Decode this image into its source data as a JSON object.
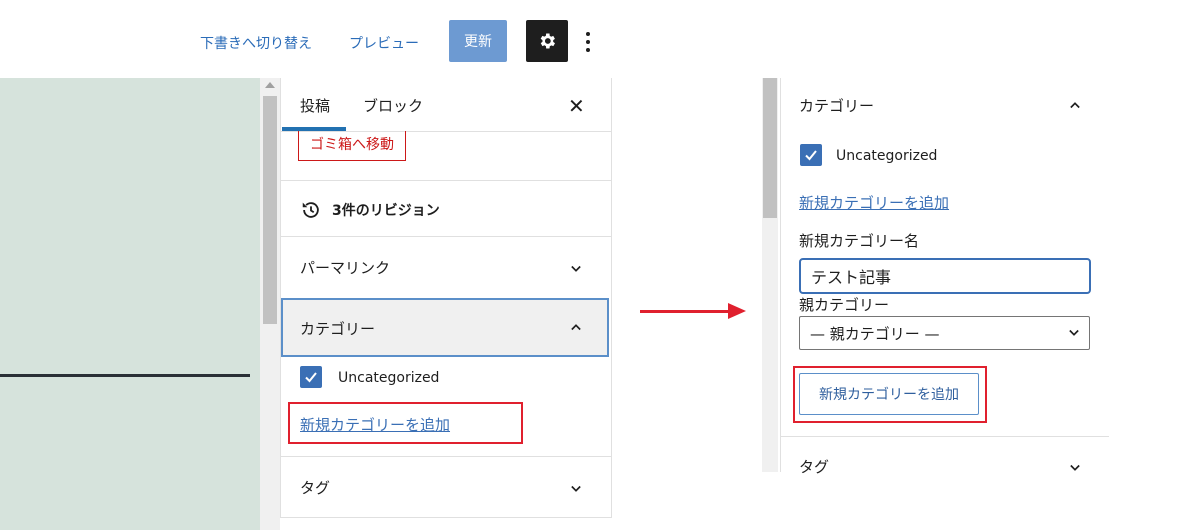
{
  "toolbar": {
    "switch_to_draft": "下書きへ切り替え",
    "preview": "プレビュー",
    "update": "更新"
  },
  "sidebar": {
    "tabs": [
      "投稿",
      "ブロック"
    ],
    "trash_label": "ゴミ箱へ移動",
    "revisions": "3件のリビジョン",
    "panels": {
      "permalink": "パーマリンク",
      "category": "カテゴリー",
      "tag": "タグ"
    },
    "category_item": "Uncategorized",
    "add_category_link": "新規カテゴリーを追加"
  },
  "expanded_panel": {
    "title": "カテゴリー",
    "category_item": "Uncategorized",
    "add_category_link": "新規カテゴリーを追加",
    "new_category_label": "新規カテゴリー名",
    "new_category_value": "テスト記事",
    "parent_label": "親カテゴリー",
    "parent_selected": "— 親カテゴリー —",
    "add_button": "新規カテゴリーを追加",
    "tag_title": "タグ"
  },
  "colors": {
    "accent": "#3a6fb5",
    "highlight": "#e0202e",
    "canvas": "#d6e3dc"
  },
  "icons": [
    "gear-icon",
    "more-vertical-icon",
    "close-icon",
    "history-icon",
    "chevron-down-icon",
    "chevron-up-icon",
    "checkmark-icon",
    "arrow-right-icon"
  ]
}
